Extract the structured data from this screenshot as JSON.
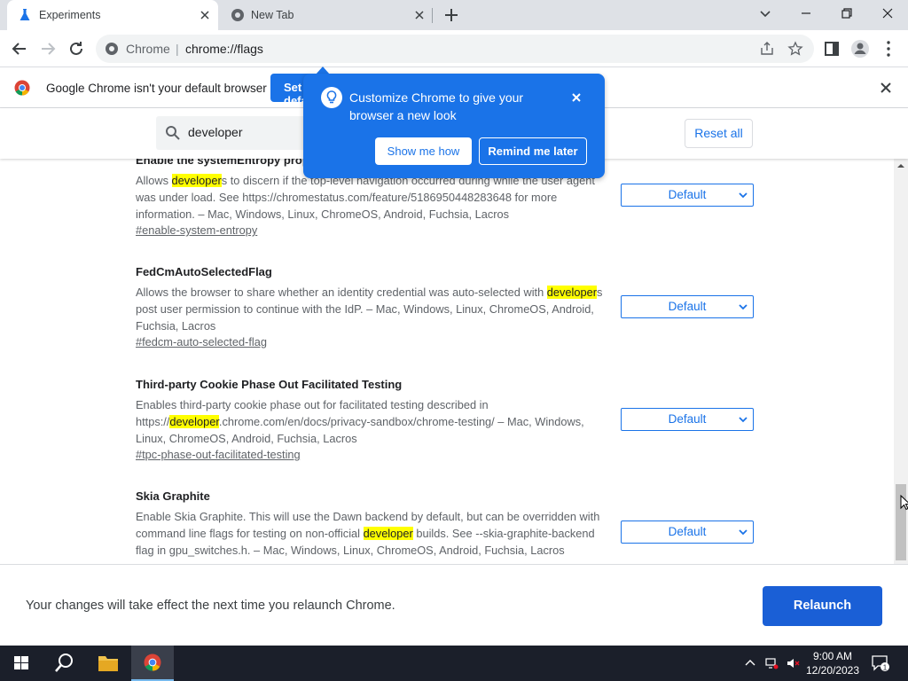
{
  "tabs": [
    {
      "title": "Experiments",
      "icon": "flask-icon",
      "active": true
    },
    {
      "title": "New Tab",
      "icon": "chrome-globe-icon",
      "active": false
    }
  ],
  "omnibox": {
    "site": "Chrome",
    "separator": "|",
    "url": "chrome://flags"
  },
  "infobar": {
    "text": "Google Chrome isn't your default browser",
    "button": "Set as default"
  },
  "bubble": {
    "title": "Customize Chrome to give your browser a new look",
    "show_button": "Show me how",
    "remind_button": "Remind me later"
  },
  "flags_header": {
    "search_value": "developer",
    "reset_label": "Reset all"
  },
  "highlight_color": "#ffff00",
  "flags": [
    {
      "name": "Enable the systemEntropy prope",
      "desc_pre": "Allows ",
      "desc_hl": "developer",
      "desc_post": "s to discern if the top-level navigation occurred during while the user agent was under load. See https://chromestatus.com/feature/5186950448283648 for more information. – Mac, Windows, Linux, ChromeOS, Android, Fuchsia, Lacros",
      "link": "#enable-system-entropy",
      "select": "Default"
    },
    {
      "name": "FedCmAutoSelectedFlag",
      "desc_pre": "Allows the browser to share whether an identity credential was auto-selected with ",
      "desc_hl": "developer",
      "desc_post": "s post user permission to continue with the IdP. – Mac, Windows, Linux, ChromeOS, Android, Fuchsia, Lacros",
      "link": "#fedcm-auto-selected-flag",
      "select": "Default"
    },
    {
      "name": "Third-party Cookie Phase Out Facilitated Testing",
      "desc_pre": "Enables third-party cookie phase out for facilitated testing described in https://",
      "desc_hl": "developer",
      "desc_post": ".chrome.com/en/docs/privacy-sandbox/chrome-testing/ – Mac, Windows, Linux, ChromeOS, Android, Fuchsia, Lacros",
      "link": "#tpc-phase-out-facilitated-testing",
      "select": "Default"
    },
    {
      "name": "Skia Graphite",
      "desc_pre": "Enable Skia Graphite. This will use the Dawn backend by default, but can be overridden with command line flags for testing on non-official ",
      "desc_hl": "developer",
      "desc_post": " builds. See --skia-graphite-backend flag in gpu_switches.h. – Mac, Windows, Linux, ChromeOS, Android, Fuchsia, Lacros",
      "link": "",
      "select": "Default"
    }
  ],
  "relaunch": {
    "text": "Your changes will take effect the next time you relaunch Chrome.",
    "button": "Relaunch"
  },
  "taskbar": {
    "time": "9:00 AM",
    "date": "12/20/2023",
    "notification_count": "1"
  }
}
